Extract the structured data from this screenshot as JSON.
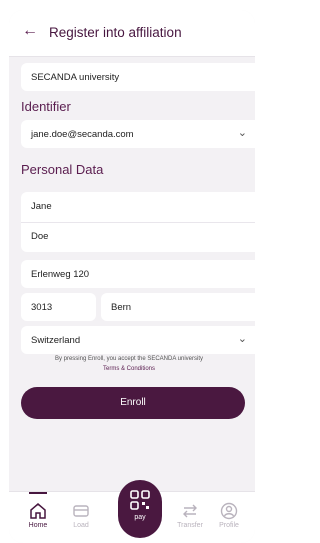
{
  "header": {
    "title": "Register into affiliation"
  },
  "university": {
    "value": "SECANDA university"
  },
  "identifier": {
    "label": "Identifier",
    "value": "jane.doe@secanda.com"
  },
  "personal": {
    "label": "Personal Data",
    "first_name": "Jane",
    "last_name": "Doe",
    "street": "Erlenweg 120",
    "zip": "3013",
    "city": "Bern",
    "country": "Switzerland"
  },
  "legal": {
    "text": "By pressing Enroll, you accept the SECANDA university",
    "link": "Terms & Conditions"
  },
  "enroll_label": "Enroll",
  "tabs": [
    {
      "label": "Home",
      "icon": "home-icon"
    },
    {
      "label": "Load",
      "icon": "card-icon"
    },
    {
      "label": "pay",
      "icon": "qr-icon"
    },
    {
      "label": "Transfer",
      "icon": "transfer-icon"
    },
    {
      "label": "Profile",
      "icon": "profile-icon"
    }
  ],
  "colors": {
    "brand": "#4a1840",
    "accent": "#5a1d4f",
    "background": "#f3f1f4"
  }
}
